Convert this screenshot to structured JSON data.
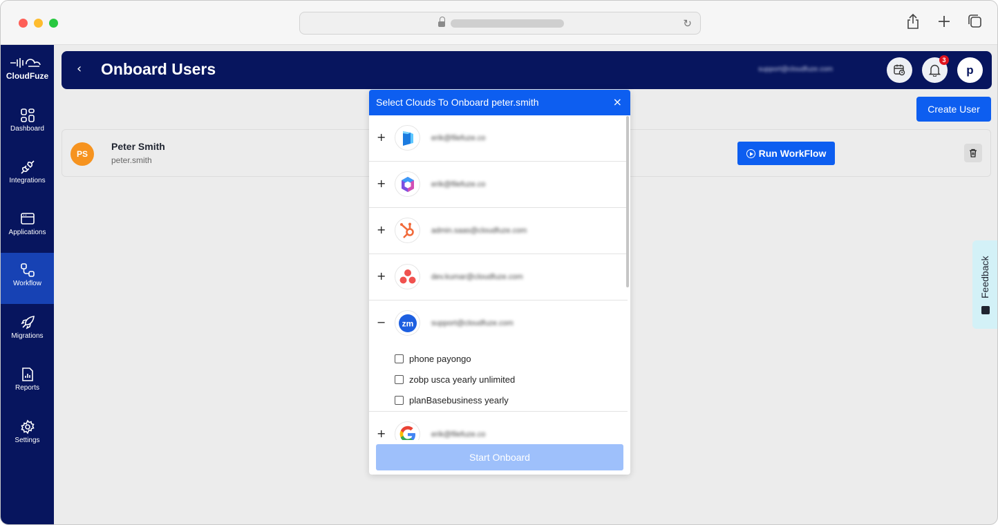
{
  "browser": {
    "reload_icon": "reload-icon",
    "share_icon": "share-icon",
    "new_tab_icon": "plus-icon",
    "tabs_icon": "tabs-icon"
  },
  "sidebar": {
    "logo_text": "CloudFuze",
    "items": [
      {
        "label": "Dashboard",
        "icon": "dashboard-icon",
        "active": false
      },
      {
        "label": "Integrations",
        "icon": "plug-icon",
        "active": false
      },
      {
        "label": "Applications",
        "icon": "window-icon",
        "active": false
      },
      {
        "label": "Workflow",
        "icon": "workflow-icon",
        "active": true
      },
      {
        "label": "Migrations",
        "icon": "rocket-icon",
        "active": false
      },
      {
        "label": "Reports",
        "icon": "report-icon",
        "active": false
      },
      {
        "label": "Settings",
        "icon": "gear-icon",
        "active": false
      }
    ]
  },
  "header": {
    "title": "Onboard Users",
    "account_email": "support@cloudfuze.com",
    "notification_count": "3",
    "profile_initial": "p"
  },
  "actions": {
    "create_user": "Create User"
  },
  "user": {
    "initials": "PS",
    "name": "Peter Smith",
    "handle": "peter.smith",
    "run_workflow": "Run WorkFlow"
  },
  "feedback": {
    "label": "Feedback"
  },
  "modal": {
    "title": "Select Clouds To Onboard peter.smith",
    "close": "×",
    "clouds": [
      {
        "email": "erik@filefuze.co",
        "toggle": "+",
        "app": "azure-ad"
      },
      {
        "email": "erik@filefuze.co",
        "toggle": "+",
        "app": "microsoft-365"
      },
      {
        "email": "admin.saas@cloudfuze.com",
        "toggle": "+",
        "app": "hubspot"
      },
      {
        "email": "dev.kumar@cloudfuze.com",
        "toggle": "+",
        "app": "asana"
      },
      {
        "email": "support@cloudfuze.com",
        "toggle": "−",
        "app": "zoom"
      },
      {
        "email": "erik@filefuze.co",
        "toggle": "+",
        "app": "google"
      }
    ],
    "plans": [
      "phone payongo",
      "zobp usca yearly unlimited",
      "planBasebusiness yearly"
    ],
    "submit": "Start Onboard"
  },
  "colors": {
    "sidebar_bg": "#07155e",
    "sidebar_active": "#1742b4",
    "primary": "#0d5ef0",
    "primary_disabled": "#9ec0fb",
    "avatar_orange": "#f6931f",
    "feedback_bg": "#d3f1f7"
  }
}
